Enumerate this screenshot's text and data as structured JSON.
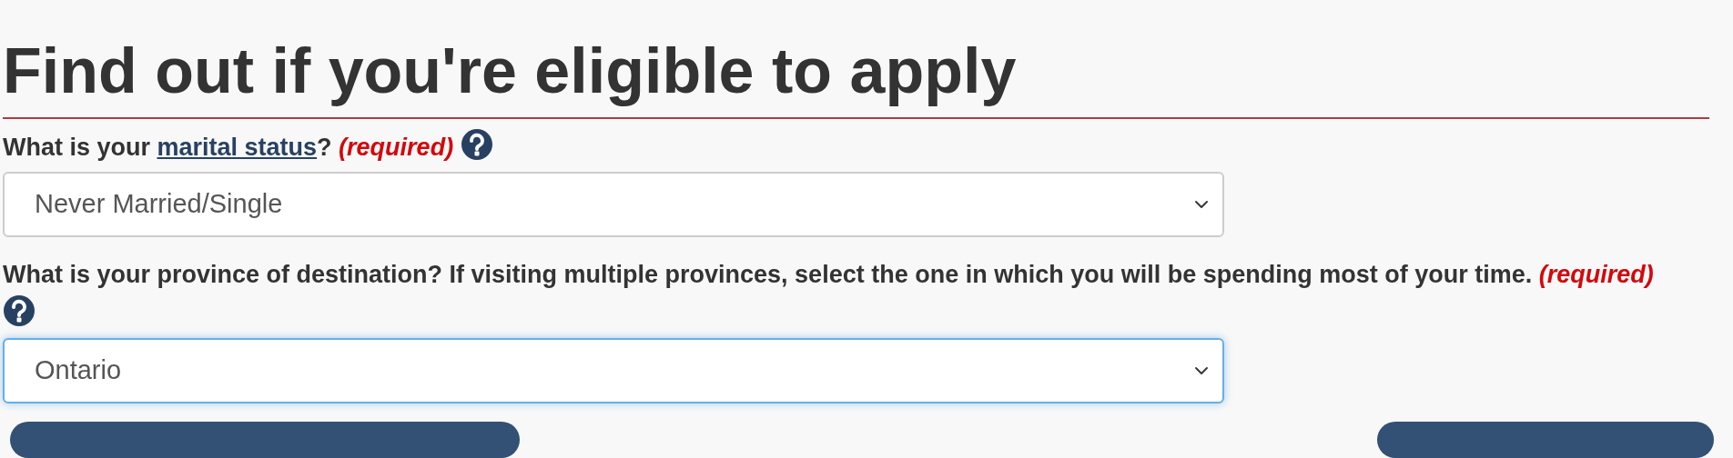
{
  "heading": "Find out if you're eligible to apply",
  "questions": [
    {
      "label_before": "What is your ",
      "link": "marital status",
      "label_after": "?",
      "required": "(required)",
      "select": {
        "value": "Never Married/Single",
        "focused": false
      }
    },
    {
      "label_before": "What is your province of destination? If visiting multiple provinces, select the one in which you will be spending most of your time.",
      "required": "(required)",
      "select": {
        "value": "Ontario",
        "focused": true
      }
    }
  ],
  "buttons": [
    {
      "kind": "wide"
    },
    {
      "kind": "narrow"
    }
  ]
}
